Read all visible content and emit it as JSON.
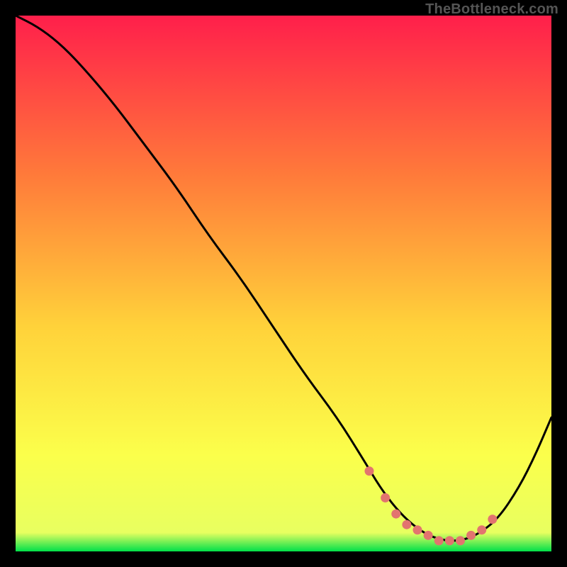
{
  "watermark": "TheBottleneck.com",
  "colors": {
    "gradient_top": "#ff1f4b",
    "gradient_upper_mid": "#ff7b3a",
    "gradient_mid": "#ffd23a",
    "gradient_lower_mid": "#fbff4b",
    "gradient_bottom": "#00e04a",
    "curve": "#000000",
    "dots": "#e2746f",
    "frame": "#000000"
  },
  "chart_data": {
    "type": "line",
    "title": "",
    "xlabel": "",
    "ylabel": "",
    "xlim": [
      0,
      100
    ],
    "ylim": [
      0,
      100
    ],
    "series": [
      {
        "name": "bottleneck-curve",
        "x": [
          0,
          4,
          8,
          12,
          18,
          24,
          30,
          36,
          42,
          48,
          54,
          60,
          65,
          68,
          71,
          74,
          77,
          80,
          83,
          86,
          90,
          94,
          97,
          100
        ],
        "y": [
          100,
          98,
          95,
          91,
          84,
          76,
          68,
          59,
          51,
          42,
          33,
          25,
          17,
          12,
          8,
          5,
          3,
          2,
          2,
          3,
          6,
          12,
          18,
          25
        ]
      }
    ],
    "markers": {
      "name": "highlighted-points",
      "x": [
        66,
        69,
        71,
        73,
        75,
        77,
        79,
        81,
        83,
        85,
        87,
        89
      ],
      "y": [
        15,
        10,
        7,
        5,
        4,
        3,
        2,
        2,
        2,
        3,
        4,
        6
      ]
    }
  }
}
